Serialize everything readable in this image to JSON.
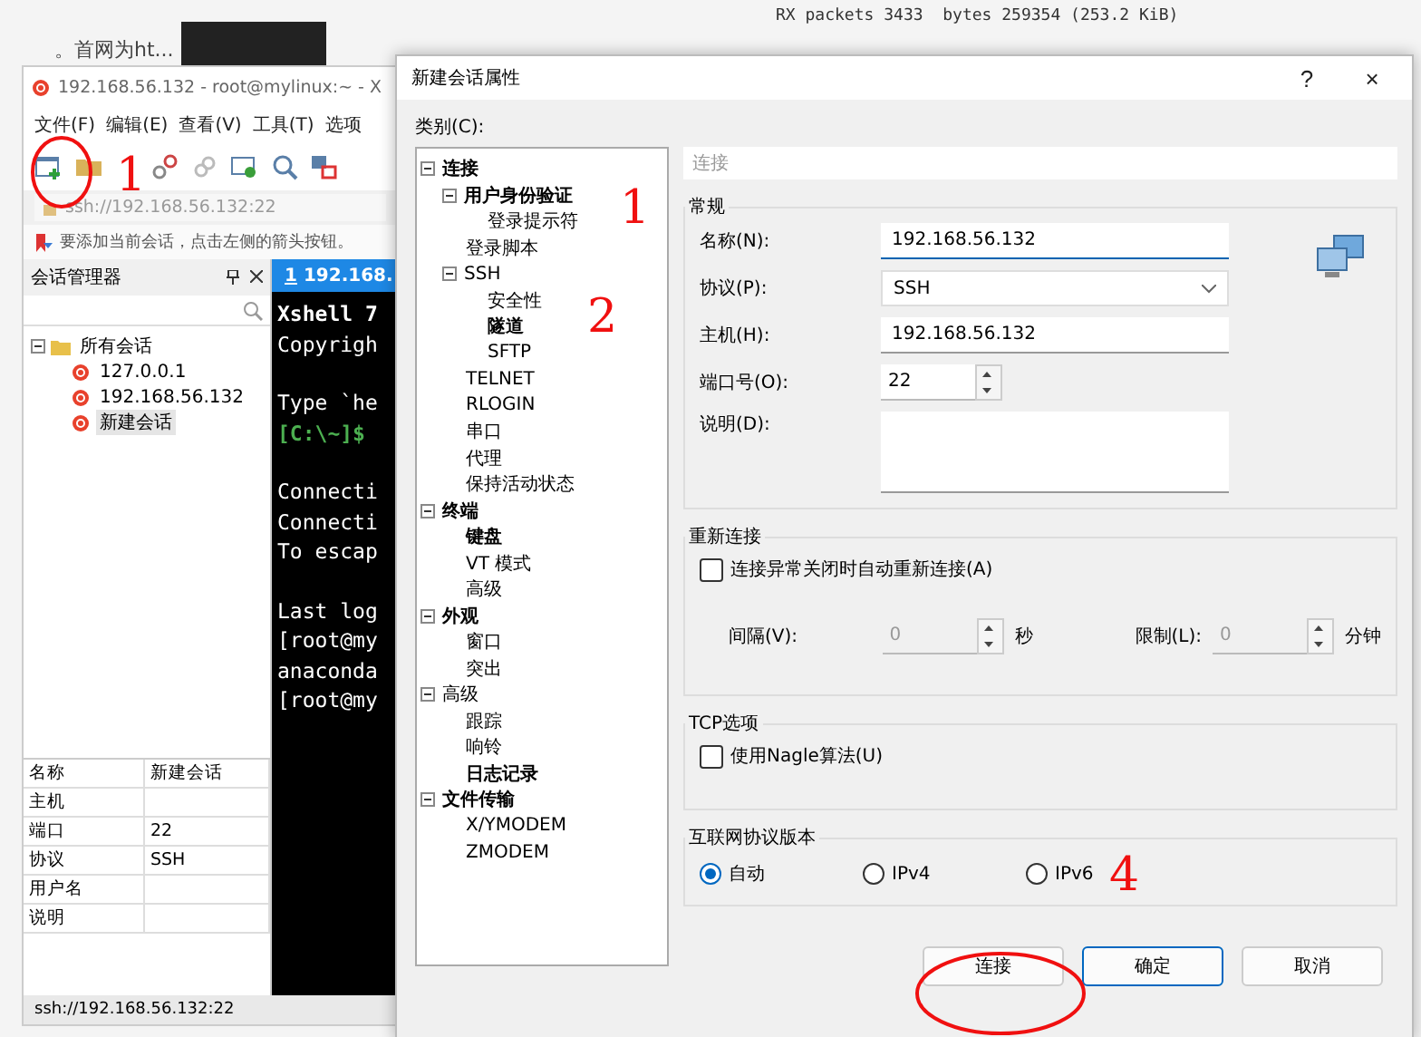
{
  "background": {
    "page_text": "。首网为ht...",
    "terminal_line": "RX packets 3433  bytes 259354 (253.2 KiB)"
  },
  "xshell": {
    "title": "192.168.56.132 - root@mylinux:~ - X",
    "menu": [
      "文件(F)",
      "编辑(E)",
      "查看(V)",
      "工具(T)",
      "选项"
    ],
    "address": "ssh://192.168.56.132:22",
    "hint": "要添加当前会话，点击左侧的箭头按钮。",
    "session_manager": {
      "title": "会话管理器",
      "root": {
        "label": "所有会话",
        "expanded": true,
        "children": [
          {
            "label": "127.0.0.1",
            "selected": false
          },
          {
            "label": "192.168.56.132",
            "selected": false
          },
          {
            "label": "新建会话",
            "selected": true
          }
        ]
      }
    },
    "properties": [
      {
        "name": "名称",
        "value": "新建会话"
      },
      {
        "name": "主机"
      },
      {
        "name": "端口",
        "value": "22"
      },
      {
        "name": "协议",
        "value": "SSH"
      },
      {
        "name": "用户名"
      },
      {
        "name": "说明"
      }
    ],
    "terminal_tab": {
      "number": "1",
      "label": "192.168.",
      "active": true
    },
    "terminal_blocks": [
      [
        {
          "kind": "bold",
          "text": "Xshell 7"
        },
        {
          "kind": "normal",
          "text": "Copyrigh"
        }
      ],
      [
        {
          "kind": "normal",
          "text": "Type `he"
        },
        {
          "kind": "prompt",
          "text": "[C:\\~]$"
        }
      ],
      [
        {
          "kind": "normal",
          "text": "Connecti"
        },
        {
          "kind": "normal",
          "text": "Connecti"
        },
        {
          "kind": "normal",
          "text": "To escap"
        }
      ],
      [
        {
          "kind": "normal",
          "text": "Last log"
        },
        {
          "kind": "normal",
          "text": "[root@my"
        },
        {
          "kind": "normal",
          "text": "anaconda"
        },
        {
          "kind": "normal",
          "text": "[root@my"
        }
      ]
    ],
    "status": "ssh://192.168.56.132:22"
  },
  "dialog": {
    "title": "新建会话属性",
    "help": "?",
    "close": "×",
    "category_label": "类别(C):",
    "tree": [
      {
        "label": "连接",
        "bold": true,
        "selected": false,
        "expanded": true,
        "children": [
          {
            "label": "用户身份验证",
            "bold": true,
            "selected": false,
            "expanded": true,
            "children": [
              {
                "label": "登录提示符",
                "bold": false,
                "selected": false
              }
            ]
          },
          {
            "label": "登录脚本",
            "bold": false,
            "selected": false
          },
          {
            "label": "SSH",
            "bold": false,
            "selected": false,
            "expanded": true,
            "children": [
              {
                "label": "安全性",
                "bold": false,
                "selected": false
              },
              {
                "label": "隧道",
                "bold": true,
                "selected": false
              },
              {
                "label": "SFTP",
                "bold": false,
                "selected": false
              }
            ]
          },
          {
            "label": "TELNET",
            "bold": false,
            "selected": false
          },
          {
            "label": "RLOGIN",
            "bold": false,
            "selected": false
          },
          {
            "label": "串口",
            "bold": false,
            "selected": false
          },
          {
            "label": "代理",
            "bold": false,
            "selected": false
          },
          {
            "label": "保持活动状态",
            "bold": false,
            "selected": false
          }
        ]
      },
      {
        "label": "终端",
        "bold": true,
        "selected": false,
        "expanded": true,
        "children": [
          {
            "label": "键盘",
            "bold": true,
            "selected": false
          },
          {
            "label": "VT 模式",
            "bold": false,
            "selected": false
          },
          {
            "label": "高级",
            "bold": false,
            "selected": false
          }
        ]
      },
      {
        "label": "外观",
        "bold": true,
        "selected": false,
        "expanded": true,
        "children": [
          {
            "label": "窗口",
            "bold": false,
            "selected": false
          },
          {
            "label": "突出",
            "bold": false,
            "selected": false
          }
        ]
      },
      {
        "label": "高级",
        "bold": false,
        "selected": false,
        "expanded": true,
        "children": [
          {
            "label": "跟踪",
            "bold": false,
            "selected": false
          },
          {
            "label": "响铃",
            "bold": false,
            "selected": false
          },
          {
            "label": "日志记录",
            "bold": true,
            "selected": false
          }
        ]
      },
      {
        "label": "文件传输",
        "bold": true,
        "selected": false,
        "expanded": true,
        "children": [
          {
            "label": "X/YMODEM",
            "bold": false,
            "selected": false
          },
          {
            "label": "ZMODEM",
            "bold": false,
            "selected": false
          }
        ]
      }
    ],
    "section_header": "连接",
    "general": {
      "title": "常规",
      "name": {
        "label": "名称(N):",
        "value": "192.168.56.132"
      },
      "protocol": {
        "label": "协议(P):",
        "value": "SSH"
      },
      "host": {
        "label": "主机(H):",
        "value": "192.168.56.132"
      },
      "port": {
        "label": "端口号(O):",
        "value": "22"
      },
      "description": {
        "label": "说明(D):"
      }
    },
    "reconnect": {
      "title": "重新连接",
      "checkbox": {
        "label": "连接异常关闭时自动重新连接(A)",
        "checked": false
      },
      "interval": {
        "label": "间隔(V):",
        "value": "0",
        "unit": "秒",
        "disabled": true
      },
      "limit": {
        "label": "限制(L):",
        "value": "0",
        "unit": "分钟",
        "disabled": true
      }
    },
    "tcp": {
      "title": "TCP选项",
      "checkbox": {
        "label": "使用Nagle算法(U)",
        "checked": false
      }
    },
    "ip_version": {
      "title": "互联网协议版本",
      "options": [
        {
          "label": "自动",
          "selected": true
        },
        {
          "label": "IPv4",
          "selected": false
        },
        {
          "label": "IPv6",
          "selected": false
        }
      ]
    },
    "buttons": [
      {
        "label": "连接",
        "default": false
      },
      {
        "label": "确定",
        "default": true
      },
      {
        "label": "取消",
        "default": false
      }
    ]
  },
  "annotation_numbers": [
    "1",
    "1",
    "2",
    "4"
  ]
}
